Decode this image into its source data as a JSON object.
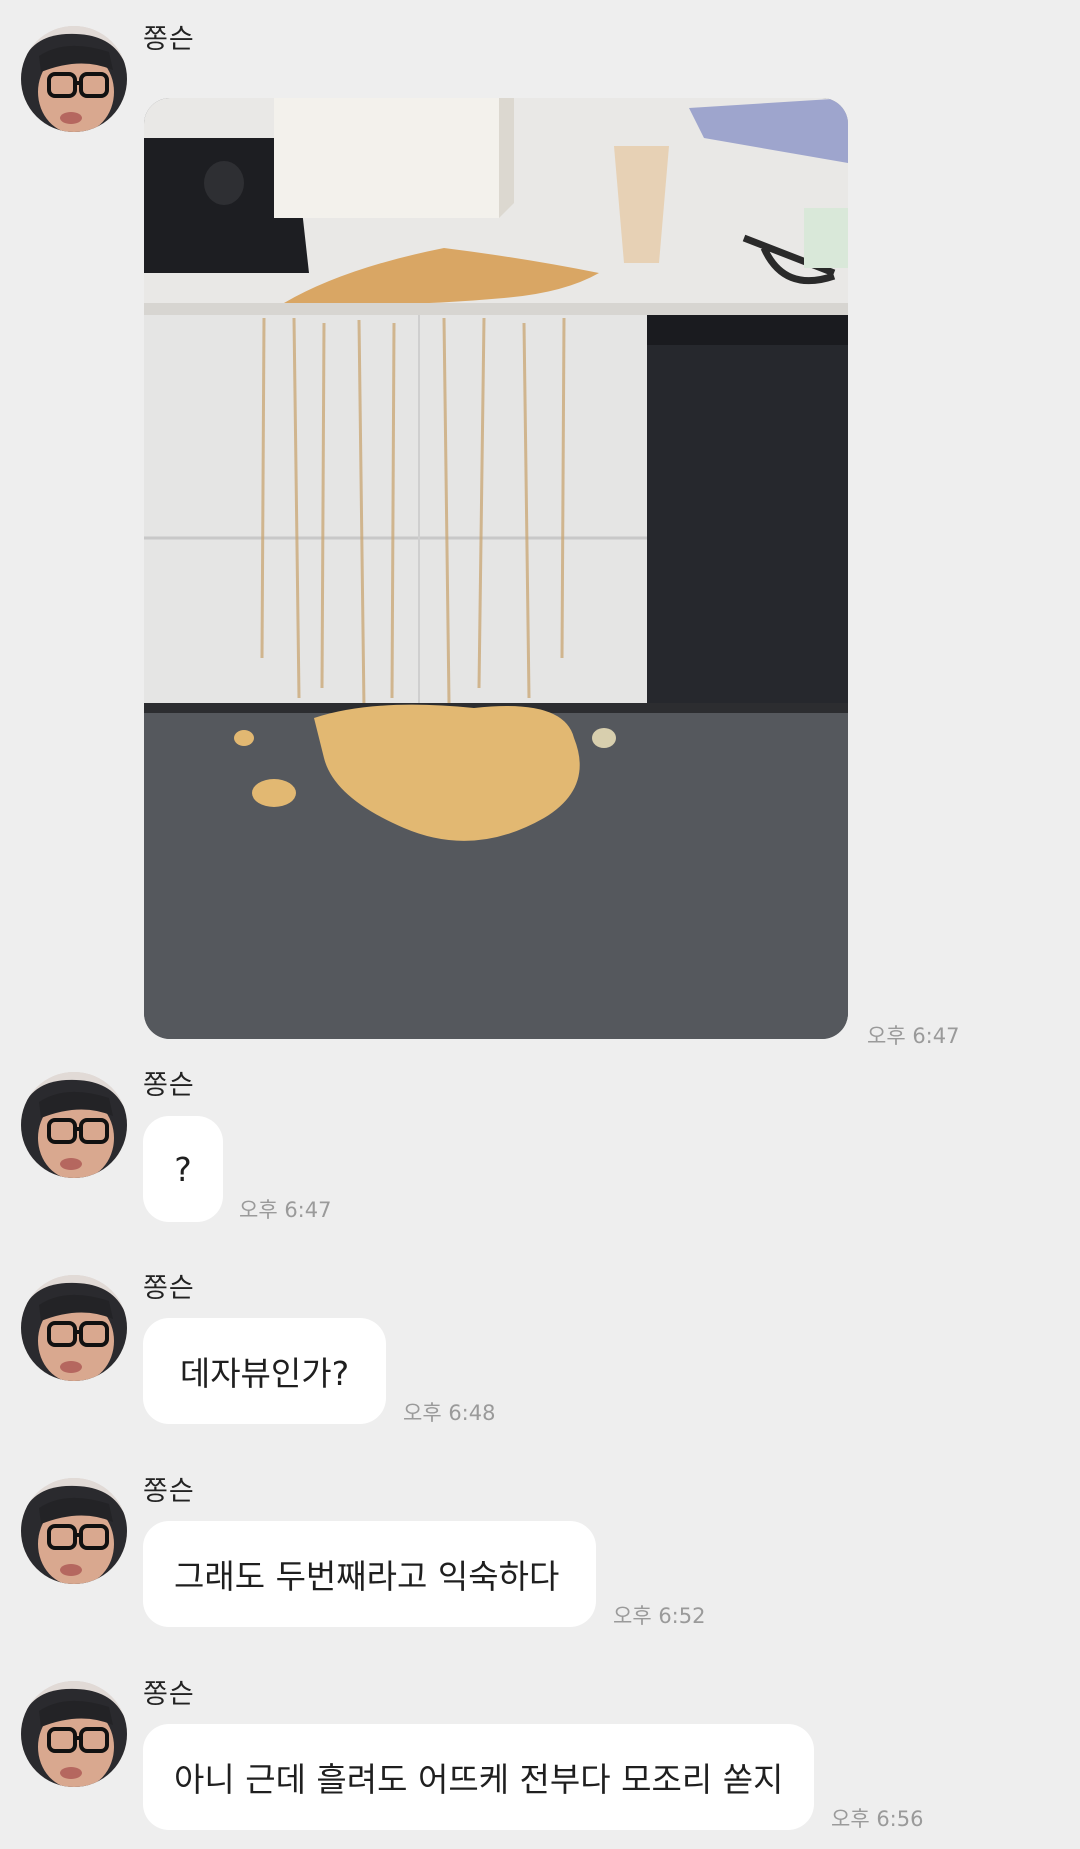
{
  "messages": [
    {
      "sender": "쫑슨",
      "type": "image",
      "time": "오후 6:47"
    },
    {
      "sender": "쫑슨",
      "type": "text",
      "text": "?",
      "time": "오후 6:47"
    },
    {
      "sender": "쫑슨",
      "type": "text",
      "text": "데자뷰인가?",
      "time": "오후 6:48"
    },
    {
      "sender": "쫑슨",
      "type": "text",
      "text": "그래도 두번째라고 익숙하다",
      "time": "오후 6:52"
    },
    {
      "sender": "쫑슨",
      "type": "text",
      "text": "아니 근데 흘려도 어뜨케 전부다 모조리 쏟지",
      "time": "오후 6:56"
    }
  ],
  "icons": {
    "avatar": "profile-photo-glasses",
    "photo": "spilled-drink-kitchen-photo"
  },
  "colors": {
    "background": "#eeeeee",
    "bubble": "#ffffff",
    "timestamp": "#9a9a9a",
    "spill": "#e2b872"
  }
}
